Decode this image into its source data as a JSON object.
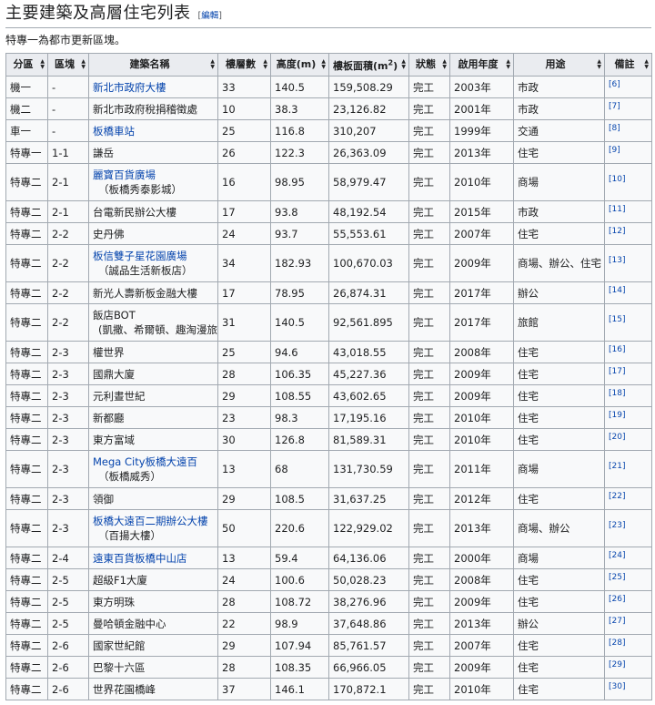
{
  "section": {
    "title": "主要建築及高層住宅列表",
    "edit_open": "[",
    "edit_label": "編輯",
    "edit_close": "]"
  },
  "note": "特專一為都市更新區塊。",
  "table": {
    "headers": [
      "分區",
      "區塊",
      "建築名稱",
      "樓層數",
      "高度(m)",
      "樓板面積(m",
      "狀態",
      "啟用年度",
      "用途",
      "備註"
    ],
    "area_sup": "2",
    "area_close": ")",
    "rows": [
      {
        "zone": "機一",
        "block": "-",
        "name": "新北市政府大樓",
        "sub": "",
        "link": true,
        "floors": "33",
        "height": "140.5",
        "area": "159,508.29",
        "status": "完工",
        "year": "2003年",
        "use": "市政",
        "ref": "[6]"
      },
      {
        "zone": "機二",
        "block": "-",
        "name": "新北市政府稅捐稽徵處",
        "sub": "",
        "link": false,
        "floors": "10",
        "height": "38.3",
        "area": "23,126.82",
        "status": "完工",
        "year": "2001年",
        "use": "市政",
        "ref": "[7]"
      },
      {
        "zone": "車一",
        "block": "-",
        "name": "板橋車站",
        "sub": "",
        "link": true,
        "floors": "25",
        "height": "116.8",
        "area": "310,207",
        "status": "完工",
        "year": "1999年",
        "use": "交通",
        "ref": "[8]"
      },
      {
        "zone": "特專一",
        "block": "1-1",
        "name": "謙岳",
        "sub": "",
        "link": false,
        "floors": "26",
        "height": "122.3",
        "area": "26,363.09",
        "status": "完工",
        "year": "2013年",
        "use": "住宅",
        "ref": "[9]"
      },
      {
        "zone": "特專二",
        "block": "2-1",
        "name": "麗寶百貨廣場",
        "sub": "（板橋秀泰影城）",
        "link": true,
        "floors": "16",
        "height": "98.95",
        "area": "58,979.47",
        "status": "完工",
        "year": "2010年",
        "use": "商場",
        "ref": "[10]"
      },
      {
        "zone": "特專二",
        "block": "2-1",
        "name": "台電新民辦公大樓",
        "sub": "",
        "link": false,
        "floors": "17",
        "height": "93.8",
        "area": "48,192.54",
        "status": "完工",
        "year": "2015年",
        "use": "市政",
        "ref": "[11]"
      },
      {
        "zone": "特專二",
        "block": "2-2",
        "name": "史丹佛",
        "sub": "",
        "link": false,
        "floors": "24",
        "height": "93.7",
        "area": "55,553.61",
        "status": "完工",
        "year": "2007年",
        "use": "住宅",
        "ref": "[12]"
      },
      {
        "zone": "特專二",
        "block": "2-2",
        "name": "板信雙子星花園廣場",
        "sub": "（誠品生活新板店）",
        "link": true,
        "floors": "34",
        "height": "182.93",
        "area": "100,670.03",
        "status": "完工",
        "year": "2009年",
        "use": "商場、辦公、住宅",
        "ref": "[13]"
      },
      {
        "zone": "特專二",
        "block": "2-2",
        "name": "新光人壽新板金融大樓",
        "sub": "",
        "link": false,
        "floors": "17",
        "height": "78.95",
        "area": "26,874.31",
        "status": "完工",
        "year": "2017年",
        "use": "辦公",
        "ref": "[14]"
      },
      {
        "zone": "特專二",
        "block": "2-2",
        "name": "飯店BOT",
        "sub": "(凱撒、希爾頓、趣淘漫旅)",
        "link": false,
        "floors": "31",
        "height": "140.5",
        "area": "92,561.895",
        "status": "完工",
        "year": "2017年",
        "use": "旅館",
        "ref": "[15]"
      },
      {
        "zone": "特專二",
        "block": "2-3",
        "name": "權世界",
        "sub": "",
        "link": false,
        "floors": "25",
        "height": "94.6",
        "area": "43,018.55",
        "status": "完工",
        "year": "2008年",
        "use": "住宅",
        "ref": "[16]"
      },
      {
        "zone": "特專二",
        "block": "2-3",
        "name": "國鼎大廈",
        "sub": "",
        "link": false,
        "floors": "28",
        "height": "106.35",
        "area": "45,227.36",
        "status": "完工",
        "year": "2009年",
        "use": "住宅",
        "ref": "[17]"
      },
      {
        "zone": "特專二",
        "block": "2-3",
        "name": "元利晝世紀",
        "sub": "",
        "link": false,
        "floors": "29",
        "height": "108.55",
        "area": "43,602.65",
        "status": "完工",
        "year": "2009年",
        "use": "住宅",
        "ref": "[18]"
      },
      {
        "zone": "特專二",
        "block": "2-3",
        "name": "新都廳",
        "sub": "",
        "link": false,
        "floors": "23",
        "height": "98.3",
        "area": "17,195.16",
        "status": "完工",
        "year": "2010年",
        "use": "住宅",
        "ref": "[19]"
      },
      {
        "zone": "特專二",
        "block": "2-3",
        "name": "東方富域",
        "sub": "",
        "link": false,
        "floors": "30",
        "height": "126.8",
        "area": "81,589.31",
        "status": "完工",
        "year": "2010年",
        "use": "住宅",
        "ref": "[20]"
      },
      {
        "zone": "特專二",
        "block": "2-3",
        "name": "Mega City板橋大遠百",
        "sub": "（板橋威秀）",
        "link": true,
        "floors": "13",
        "height": "68",
        "area": "131,730.59",
        "status": "完工",
        "year": "2011年",
        "use": "商場",
        "ref": "[21]"
      },
      {
        "zone": "特專二",
        "block": "2-3",
        "name": "領御",
        "sub": "",
        "link": false,
        "floors": "29",
        "height": "108.5",
        "area": "31,637.25",
        "status": "完工",
        "year": "2012年",
        "use": "住宅",
        "ref": "[22]"
      },
      {
        "zone": "特專二",
        "block": "2-3",
        "name": "板橋大遠百二期辦公大樓",
        "sub": "（百揚大樓）",
        "link": true,
        "floors": "50",
        "height": "220.6",
        "area": "122,929.02",
        "status": "完工",
        "year": "2013年",
        "use": "商場、辦公",
        "ref": "[23]"
      },
      {
        "zone": "特專二",
        "block": "2-4",
        "name": "遠東百貨板橋中山店",
        "sub": "",
        "link": true,
        "floors": "13",
        "height": "59.4",
        "area": "64,136.06",
        "status": "完工",
        "year": "2000年",
        "use": "商場",
        "ref": "[24]"
      },
      {
        "zone": "特專二",
        "block": "2-5",
        "name": "超級F1大廈",
        "sub": "",
        "link": false,
        "floors": "24",
        "height": "100.6",
        "area": "50,028.23",
        "status": "完工",
        "year": "2008年",
        "use": "住宅",
        "ref": "[25]"
      },
      {
        "zone": "特專二",
        "block": "2-5",
        "name": "東方明珠",
        "sub": "",
        "link": false,
        "floors": "28",
        "height": "108.72",
        "area": "38,276.96",
        "status": "完工",
        "year": "2009年",
        "use": "住宅",
        "ref": "[26]"
      },
      {
        "zone": "特專二",
        "block": "2-5",
        "name": "曼哈頓金融中心",
        "sub": "",
        "link": false,
        "floors": "22",
        "height": "98.9",
        "area": "37,648.86",
        "status": "完工",
        "year": "2013年",
        "use": "辦公",
        "ref": "[27]"
      },
      {
        "zone": "特專二",
        "block": "2-6",
        "name": "國家世紀館",
        "sub": "",
        "link": false,
        "floors": "29",
        "height": "107.94",
        "area": "85,761.57",
        "status": "完工",
        "year": "2007年",
        "use": "住宅",
        "ref": "[28]"
      },
      {
        "zone": "特專二",
        "block": "2-6",
        "name": "巴黎十六區",
        "sub": "",
        "link": false,
        "floors": "28",
        "height": "108.35",
        "area": "66,966.05",
        "status": "完工",
        "year": "2009年",
        "use": "住宅",
        "ref": "[29]"
      },
      {
        "zone": "特專二",
        "block": "2-6",
        "name": "世界花園橋峰",
        "sub": "",
        "link": false,
        "floors": "37",
        "height": "146.1",
        "area": "170,872.1",
        "status": "完工",
        "year": "2010年",
        "use": "住宅",
        "ref": "[30]"
      }
    ]
  },
  "colors": {
    "link": "#0645ad",
    "header_bg": "#eaecf0",
    "cell_bg": "#f8f9fa",
    "border": "#a2a9b1"
  }
}
